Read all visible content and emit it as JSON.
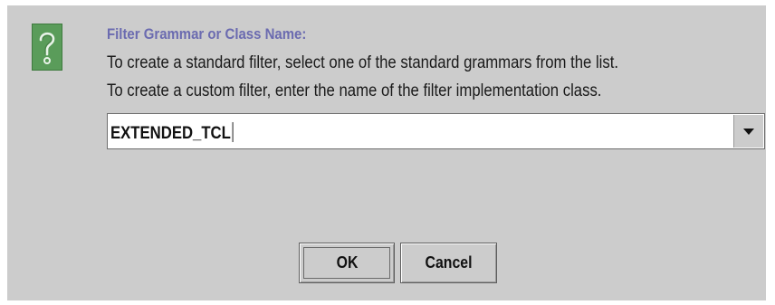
{
  "dialog": {
    "icon": "question-icon",
    "title": "Filter Grammar or Class Name:",
    "line1": "To create a standard filter, select one of the standard grammars from the list.",
    "line2": "To create a custom filter, enter the name of the filter implementation class.",
    "combo_value": "EXTENDED_TCL",
    "combo_arrow_icon": "triangle-down-icon",
    "ok_label": "OK",
    "cancel_label": "Cancel"
  },
  "colors": {
    "background": "#cccccc",
    "title": "#6b6bb0",
    "icon_green": "#5a9c5a"
  }
}
